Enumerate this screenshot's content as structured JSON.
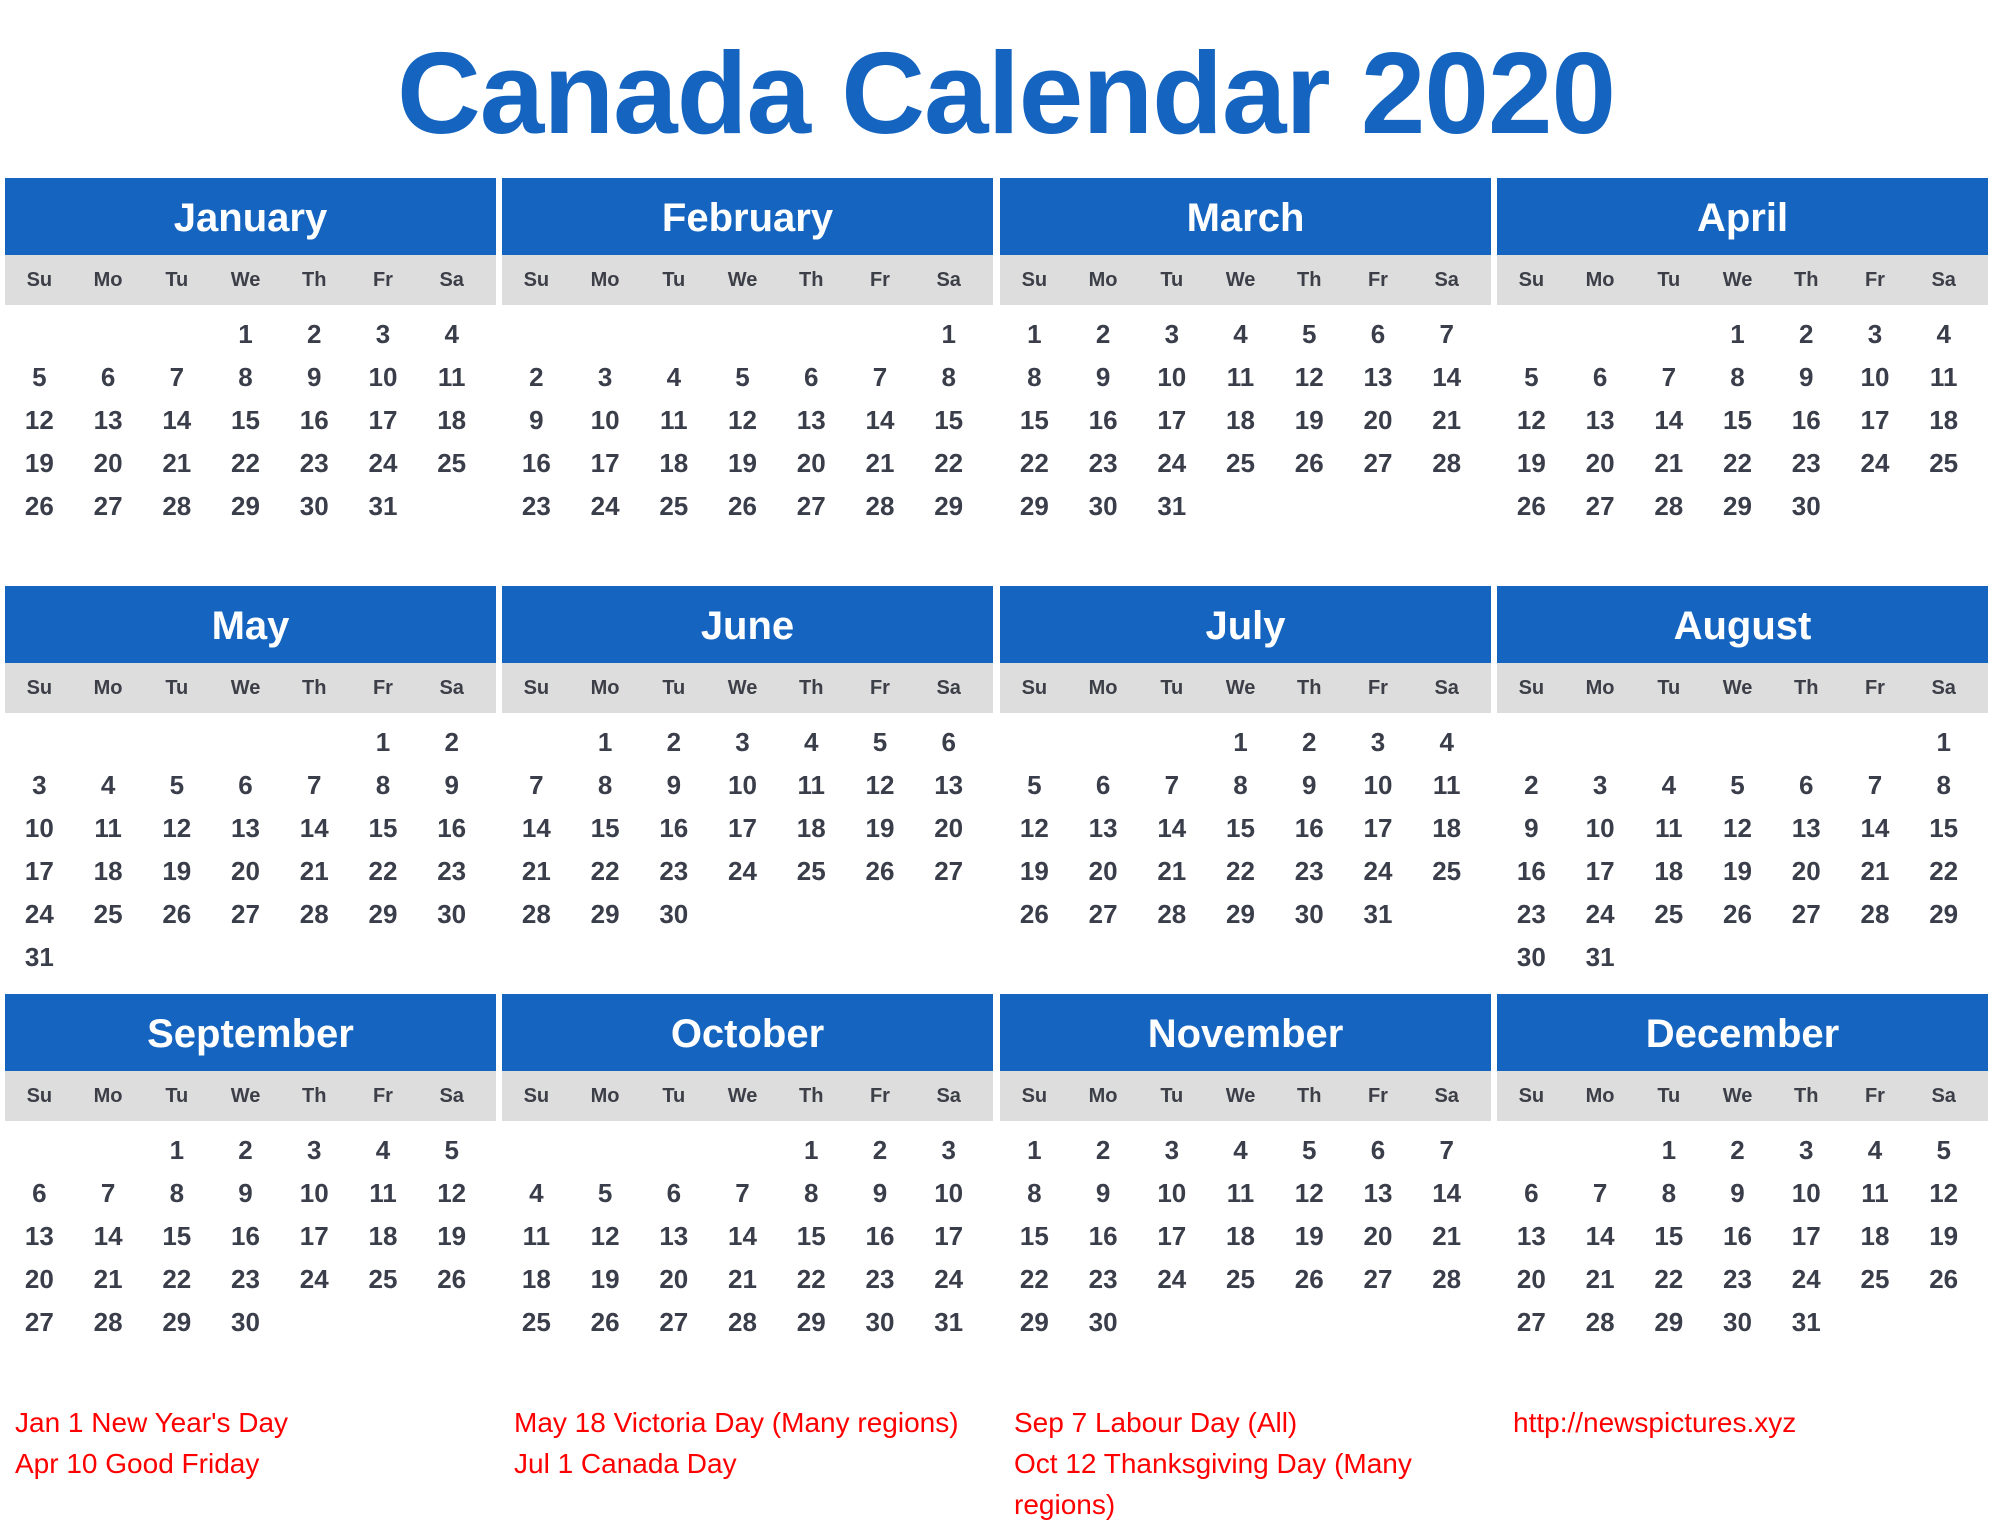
{
  "title": "Canada Calendar 2020",
  "colors": {
    "header_blue": "#1565c0",
    "weekday_bar": "#dddddd",
    "day_text": "#3a3e4a",
    "holiday_red": "#ff0000"
  },
  "weekdays": [
    "Su",
    "Mo",
    "Tu",
    "We",
    "Th",
    "Fr",
    "Sa"
  ],
  "months": [
    {
      "name": "January",
      "weeks": [
        [
          "",
          "",
          "",
          "1",
          "2",
          "3",
          "4"
        ],
        [
          "5",
          "6",
          "7",
          "8",
          "9",
          "10",
          "11"
        ],
        [
          "12",
          "13",
          "14",
          "15",
          "16",
          "17",
          "18"
        ],
        [
          "19",
          "20",
          "21",
          "22",
          "23",
          "24",
          "25"
        ],
        [
          "26",
          "27",
          "28",
          "29",
          "30",
          "31",
          ""
        ]
      ]
    },
    {
      "name": "February",
      "weeks": [
        [
          "",
          "",
          "",
          "",
          "",
          "",
          "1"
        ],
        [
          "2",
          "3",
          "4",
          "5",
          "6",
          "7",
          "8"
        ],
        [
          "9",
          "10",
          "11",
          "12",
          "13",
          "14",
          "15"
        ],
        [
          "16",
          "17",
          "18",
          "19",
          "20",
          "21",
          "22"
        ],
        [
          "23",
          "24",
          "25",
          "26",
          "27",
          "28",
          "29"
        ]
      ]
    },
    {
      "name": "March",
      "weeks": [
        [
          "1",
          "2",
          "3",
          "4",
          "5",
          "6",
          "7"
        ],
        [
          "8",
          "9",
          "10",
          "11",
          "12",
          "13",
          "14"
        ],
        [
          "15",
          "16",
          "17",
          "18",
          "19",
          "20",
          "21"
        ],
        [
          "22",
          "23",
          "24",
          "25",
          "26",
          "27",
          "28"
        ],
        [
          "29",
          "30",
          "31",
          "",
          "",
          "",
          ""
        ]
      ]
    },
    {
      "name": "April",
      "weeks": [
        [
          "",
          "",
          "",
          "1",
          "2",
          "3",
          "4"
        ],
        [
          "5",
          "6",
          "7",
          "8",
          "9",
          "10",
          "11"
        ],
        [
          "12",
          "13",
          "14",
          "15",
          "16",
          "17",
          "18"
        ],
        [
          "19",
          "20",
          "21",
          "22",
          "23",
          "24",
          "25"
        ],
        [
          "26",
          "27",
          "28",
          "29",
          "30",
          "",
          ""
        ]
      ]
    },
    {
      "name": "May",
      "weeks": [
        [
          "",
          "",
          "",
          "",
          "",
          "1",
          "2"
        ],
        [
          "3",
          "4",
          "5",
          "6",
          "7",
          "8",
          "9"
        ],
        [
          "10",
          "11",
          "12",
          "13",
          "14",
          "15",
          "16"
        ],
        [
          "17",
          "18",
          "19",
          "20",
          "21",
          "22",
          "23"
        ],
        [
          "24",
          "25",
          "26",
          "27",
          "28",
          "29",
          "30"
        ],
        [
          "31",
          "",
          "",
          "",
          "",
          "",
          ""
        ]
      ]
    },
    {
      "name": "June",
      "weeks": [
        [
          "",
          "1",
          "2",
          "3",
          "4",
          "5",
          "6"
        ],
        [
          "7",
          "8",
          "9",
          "10",
          "11",
          "12",
          "13"
        ],
        [
          "14",
          "15",
          "16",
          "17",
          "18",
          "19",
          "20"
        ],
        [
          "21",
          "22",
          "23",
          "24",
          "25",
          "26",
          "27"
        ],
        [
          "28",
          "29",
          "30",
          "",
          "",
          "",
          ""
        ]
      ]
    },
    {
      "name": "July",
      "weeks": [
        [
          "",
          "",
          "",
          "1",
          "2",
          "3",
          "4"
        ],
        [
          "5",
          "6",
          "7",
          "8",
          "9",
          "10",
          "11"
        ],
        [
          "12",
          "13",
          "14",
          "15",
          "16",
          "17",
          "18"
        ],
        [
          "19",
          "20",
          "21",
          "22",
          "23",
          "24",
          "25"
        ],
        [
          "26",
          "27",
          "28",
          "29",
          "30",
          "31",
          ""
        ]
      ]
    },
    {
      "name": "August",
      "weeks": [
        [
          "",
          "",
          "",
          "",
          "",
          "",
          "1"
        ],
        [
          "2",
          "3",
          "4",
          "5",
          "6",
          "7",
          "8"
        ],
        [
          "9",
          "10",
          "11",
          "12",
          "13",
          "14",
          "15"
        ],
        [
          "16",
          "17",
          "18",
          "19",
          "20",
          "21",
          "22"
        ],
        [
          "23",
          "24",
          "25",
          "26",
          "27",
          "28",
          "29"
        ],
        [
          "30",
          "31",
          "",
          "",
          "",
          "",
          ""
        ]
      ]
    },
    {
      "name": "September",
      "weeks": [
        [
          "",
          "",
          "1",
          "2",
          "3",
          "4",
          "5"
        ],
        [
          "6",
          "7",
          "8",
          "9",
          "10",
          "11",
          "12"
        ],
        [
          "13",
          "14",
          "15",
          "16",
          "17",
          "18",
          "19"
        ],
        [
          "20",
          "21",
          "22",
          "23",
          "24",
          "25",
          "26"
        ],
        [
          "27",
          "28",
          "29",
          "30",
          "",
          "",
          ""
        ]
      ]
    },
    {
      "name": "October",
      "weeks": [
        [
          "",
          "",
          "",
          "",
          "1",
          "2",
          "3"
        ],
        [
          "4",
          "5",
          "6",
          "7",
          "8",
          "9",
          "10"
        ],
        [
          "11",
          "12",
          "13",
          "14",
          "15",
          "16",
          "17"
        ],
        [
          "18",
          "19",
          "20",
          "21",
          "22",
          "23",
          "24"
        ],
        [
          "25",
          "26",
          "27",
          "28",
          "29",
          "30",
          "31"
        ]
      ]
    },
    {
      "name": "November",
      "weeks": [
        [
          "1",
          "2",
          "3",
          "4",
          "5",
          "6",
          "7"
        ],
        [
          "8",
          "9",
          "10",
          "11",
          "12",
          "13",
          "14"
        ],
        [
          "15",
          "16",
          "17",
          "18",
          "19",
          "20",
          "21"
        ],
        [
          "22",
          "23",
          "24",
          "25",
          "26",
          "27",
          "28"
        ],
        [
          "29",
          "30",
          "",
          "",
          "",
          "",
          ""
        ]
      ]
    },
    {
      "name": "December",
      "weeks": [
        [
          "",
          "",
          "1",
          "2",
          "3",
          "4",
          "5"
        ],
        [
          "6",
          "7",
          "8",
          "9",
          "10",
          "11",
          "12"
        ],
        [
          "13",
          "14",
          "15",
          "16",
          "17",
          "18",
          "19"
        ],
        [
          "20",
          "21",
          "22",
          "23",
          "24",
          "25",
          "26"
        ],
        [
          "27",
          "28",
          "29",
          "30",
          "31",
          "",
          ""
        ]
      ]
    }
  ],
  "holiday_columns": [
    [
      "Jan 1 New Year's Day",
      "Apr 10 Good Friday"
    ],
    [
      "May 18 Victoria Day (Many regions)",
      "Jul 1 Canada Day"
    ],
    [
      "Sep 7 Labour Day (All)",
      "Oct 12 Thanksgiving Day (Many regions)"
    ],
    [
      "http://newspictures.xyz"
    ]
  ]
}
